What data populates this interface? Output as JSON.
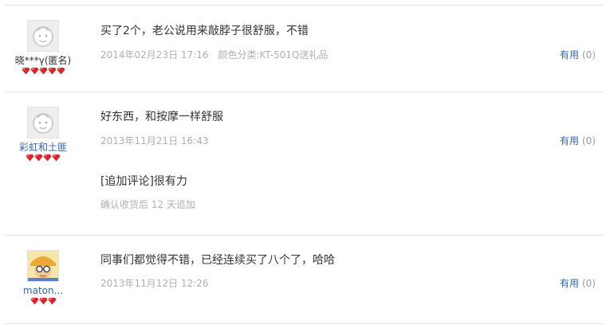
{
  "reviews": [
    {
      "username": "晓***γ(匿名)",
      "avatar_icon": "default-avatar-icon",
      "rating": 5,
      "content": "买了2个，老公说用来敲脖子很舒服，不错",
      "date": "2014年02月23日 17:16",
      "sku": "颜色分类:KT-501Q送礼品",
      "useful_label": "有用",
      "useful_count": "(0)"
    },
    {
      "username": "彩虹和土匪",
      "avatar_icon": "default-avatar-icon",
      "rating": 4,
      "content": "好东西，和按摩一样舒服",
      "date": "2013年11月21日 16:43",
      "useful_label": "有用",
      "useful_count": "(0)",
      "append": {
        "content": "[追加评论]很有力",
        "note": "确认收货后 12 天追加"
      }
    },
    {
      "username": "maton...",
      "avatar_icon": "photo-avatar-icon",
      "rating": 3,
      "content": "同事们都觉得不错，已经连续买了八个了，哈哈",
      "date": "2013年11月12日 12:26",
      "useful_label": "有用",
      "useful_count": "(0)"
    }
  ],
  "colors": {
    "link": "#3366aa",
    "meta": "#b0b0b0",
    "star": "#d9262b",
    "divider": "#e2e2e2"
  }
}
